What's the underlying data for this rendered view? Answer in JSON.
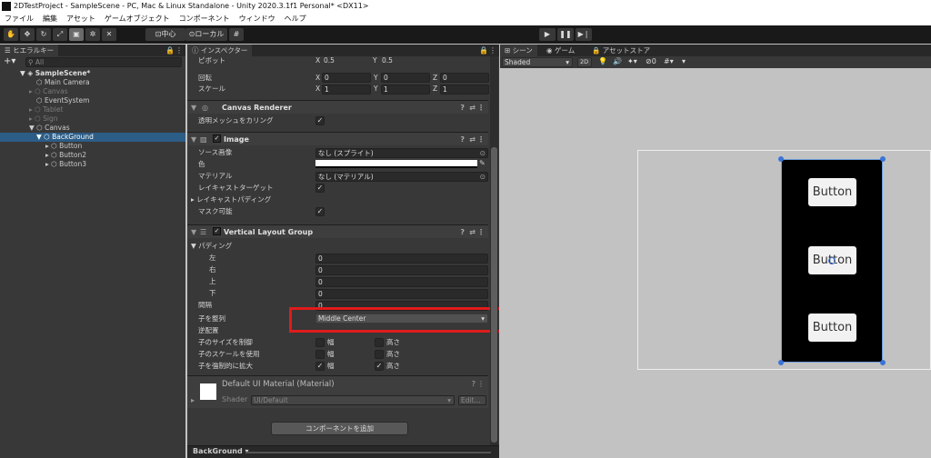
{
  "window": {
    "title": "2DTestProject - SampleScene - PC, Mac & Linux Standalone - Unity 2020.3.1f1 Personal* <DX11>"
  },
  "menu": [
    "ファイル",
    "編集",
    "アセット",
    "ゲームオブジェクト",
    "コンポーネント",
    "ウィンドウ",
    "ヘルプ"
  ],
  "toolbar": {
    "pivot_label": "中心",
    "space_label": "ローカル"
  },
  "hierarchy": {
    "tab": "ヒエラルキー",
    "search_placeholder": "All",
    "items": [
      {
        "label": "SampleScene*",
        "depth": 0
      },
      {
        "label": "Main Camera",
        "depth": 1
      },
      {
        "label": "Canvas",
        "depth": 1
      },
      {
        "label": "EventSystem",
        "depth": 1
      },
      {
        "label": "Tablet",
        "depth": 1
      },
      {
        "label": "Sign",
        "depth": 1
      },
      {
        "label": "Canvas",
        "depth": 1
      },
      {
        "label": "BackGround",
        "depth": 2
      },
      {
        "label": "Button",
        "depth": 3
      },
      {
        "label": "Button2",
        "depth": 3
      },
      {
        "label": "Button3",
        "depth": 3
      }
    ]
  },
  "inspector": {
    "tab": "インスペクター",
    "transform": {
      "pivot_label": "ピボット",
      "pivot_x": "0.5",
      "pivot_y": "0.5",
      "rotation_label": "回転",
      "rot_x": "0",
      "rot_y": "0",
      "rot_z": "0",
      "scale_label": "スケール",
      "scale_x": "1",
      "scale_y": "1",
      "scale_z": "1",
      "x": "X",
      "y": "Y",
      "z": "Z"
    },
    "canvas_renderer": {
      "title": "Canvas Renderer",
      "cull_label": "透明メッシュをカリング"
    },
    "image": {
      "title": "Image",
      "source_label": "ソース画像",
      "source_value": "なし (スプライト)",
      "color_label": "色",
      "material_label": "マテリアル",
      "material_value": "なし (マテリアル)",
      "raycast_label": "レイキャストターゲット",
      "raycast_padding_label": "レイキャストパディング",
      "maskable_label": "マスク可能"
    },
    "vlg": {
      "title": "Vertical Layout Group",
      "padding_label": "パディング",
      "left_label": "左",
      "left": "0",
      "right_label": "右",
      "right": "0",
      "top_label": "上",
      "top": "0",
      "bottom_label": "下",
      "bottom": "0",
      "spacing_label": "間隔",
      "spacing": "0",
      "align_label": "子を整列",
      "align_value": "Middle Center",
      "reverse_label": "逆配置",
      "control_label": "子のサイズを制御",
      "scale_label": "子のスケールを使用",
      "expand_label": "子を強制的に拡大",
      "width": "幅",
      "height": "高さ"
    },
    "material": {
      "title": "Default UI Material (Material)",
      "shader_label": "Shader",
      "shader_value": "UI/Default",
      "edit_label": "Edit..."
    },
    "add_component": "コンポーネントを追加",
    "footer": "BackGround"
  },
  "scene": {
    "tabs": [
      "シーン",
      "ゲーム",
      "アセットストア"
    ],
    "shading": "Shaded",
    "mode_2d": "2D",
    "gizmo_count": "0",
    "buttons": [
      "Button",
      "Button",
      "Button"
    ]
  },
  "colors": {
    "highlight": "#e01b1b",
    "selection": "#2c5d87"
  }
}
